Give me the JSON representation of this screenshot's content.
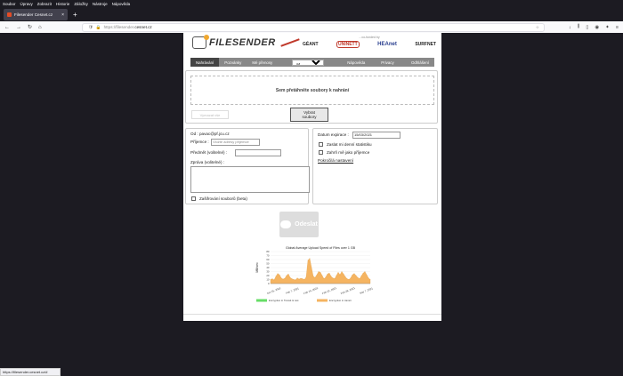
{
  "browser": {
    "menu": [
      "Soubor",
      "Úpravy",
      "Zobrazit",
      "Historie",
      "Záložky",
      "Nástroje",
      "Nápověda"
    ],
    "tab_title": "Filesender Cesnet.cz",
    "tab_close": "×",
    "new_tab": "+",
    "url_prefix": "https://filesender.",
    "url_domain": "cesnet.cz",
    "status_url": "https://filesender.cesnet.cz/#"
  },
  "app": {
    "logo_text": "FILESENDER",
    "partners_caption": "...co-funded by",
    "partners": [
      "GÉANT",
      "UNINETT",
      "HEAnet",
      "SURFNET"
    ],
    "menu": {
      "upload": "Nahrávání",
      "invitations": "Pozvánky",
      "my_transfers": "Mé přenosy",
      "language": "cz",
      "help": "Nápověda",
      "privacy": "Privacy",
      "logout": "Odhlášení"
    },
    "upload": {
      "drop_text": "Sem přetáhněte soubory k nahrání",
      "clear_all": "Vymazat vše",
      "select_files_line1": "Vybrat",
      "select_files_line2": "soubory"
    },
    "form": {
      "from_label": "Od : pavac@pf.jcu.cz",
      "recipients_label": "Příjemce :",
      "recipients_placeholder": "Vložte adresy příjemce",
      "subject_label": "Předmět (volitelné) :",
      "message_label": "Zpráva (volitelné) :",
      "encryption_label": "Zašifrování souborů (beta)",
      "expiry_label": "Datum expirace :",
      "expiry_value": "15/03/2021",
      "stats_label": "Zaslat mi denní statistiku",
      "include_me_label": "Zahrň mě jako příjemce",
      "advanced_link": "Pokročilá nastavení"
    },
    "send_button": "Odeslat",
    "colors": {
      "menu_bg": "#888888",
      "menu_active": "#444444",
      "chart_fill": "#f5b461",
      "legend_green": "#66dd66"
    }
  },
  "chart_data": {
    "type": "area",
    "title": "Global Average Upload Speed of Files over 1 GB",
    "ylabel": "MB/sec",
    "ylim": [
      0,
      80
    ],
    "yticks": [
      0,
      10,
      20,
      30,
      40,
      50,
      60,
      70,
      80
    ],
    "xticklabels": [
      "Jan 31, 2021",
      "Feb 7, 2021",
      "Feb 14, 2021",
      "Feb 21, 2021",
      "Feb 28, 2021",
      "Mar 7, 2021"
    ],
    "series": [
      {
        "name": "Encryption in Transit & rest",
        "color": "#66dd66",
        "values": []
      },
      {
        "name": "Encryption in transit",
        "color": "#f5b461",
        "values": [
          10,
          12,
          9,
          18,
          25,
          22,
          14,
          11,
          13,
          20,
          24,
          15,
          12,
          10,
          9,
          14,
          11,
          13,
          12,
          10,
          16,
          58,
          63,
          40,
          18,
          15,
          22,
          30,
          28,
          20,
          12,
          16,
          24,
          26,
          18,
          14,
          12,
          20,
          28,
          22,
          30,
          24,
          17,
          12,
          10,
          14,
          22,
          25,
          20,
          15,
          12,
          19,
          26,
          30,
          22,
          14,
          10
        ]
      }
    ]
  }
}
